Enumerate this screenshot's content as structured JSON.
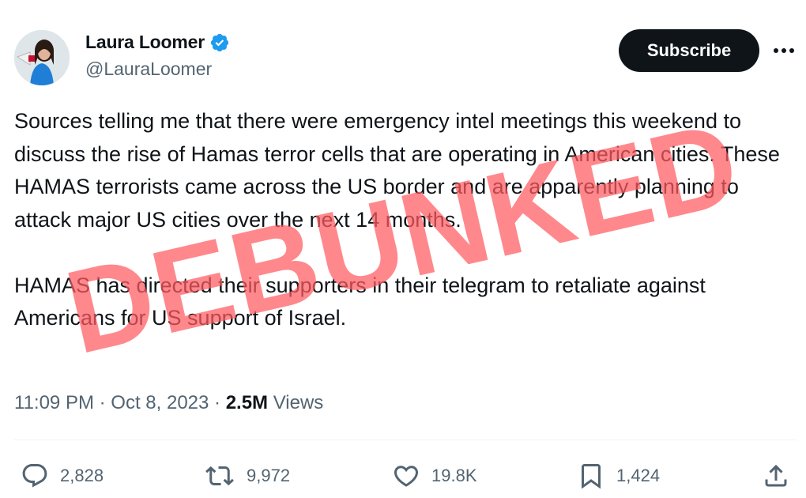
{
  "author": {
    "display_name": "Laura Loomer",
    "handle": "@LauraLoomer",
    "verified": true,
    "avatar_icon": "avatar-photo-icon"
  },
  "subscribe_label": "Subscribe",
  "more_icon": "more-dots-icon",
  "tweet": {
    "paragraphs": [
      "Sources telling me that there were emergency intel meetings this weekend to discuss the rise of Hamas terror cells that are operating in American cities. These HAMAS terrorists came across the US border and are apparently planning to attack major US cities over the next 14 months.",
      "HAMAS has directed their supporters in their telegram to retaliate against Americans for US support of Israel."
    ]
  },
  "meta": {
    "time": "11:09 PM",
    "date": "Oct 8, 2023",
    "views_count": "2.5M",
    "views_label": "Views"
  },
  "actions": {
    "replies": "2,828",
    "reposts": "9,972",
    "likes": "19.8K",
    "bookmarks": "1,424"
  },
  "overlay": {
    "stamp_text": "DEBUNKED",
    "stamp_color": "#ff5a5f"
  },
  "colors": {
    "text_primary": "#0f1419",
    "text_secondary": "#536471",
    "verified_blue": "#1d9bf0",
    "button_bg": "#0f1419"
  }
}
